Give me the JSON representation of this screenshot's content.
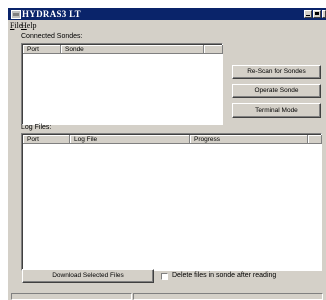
{
  "window": {
    "title": "HYDRAS3 LT"
  },
  "menu": {
    "file": {
      "first": "F",
      "rest": "ile"
    },
    "help": {
      "first": "H",
      "rest": "elp"
    }
  },
  "sondes": {
    "label": "Connected Sondes:",
    "columns": [
      "Port",
      "Sonde",
      ""
    ]
  },
  "actions": {
    "rescan": "Re-Scan for Sondes",
    "operate": "Operate Sonde",
    "terminal": "Terminal Mode"
  },
  "logs": {
    "label": "Log Files:",
    "columns": [
      "Port",
      "Log File",
      "Progress",
      ""
    ]
  },
  "download_button": "Download Selected Files",
  "delete_checkbox": {
    "label": "Delete files in sonde after reading",
    "checked": false
  }
}
